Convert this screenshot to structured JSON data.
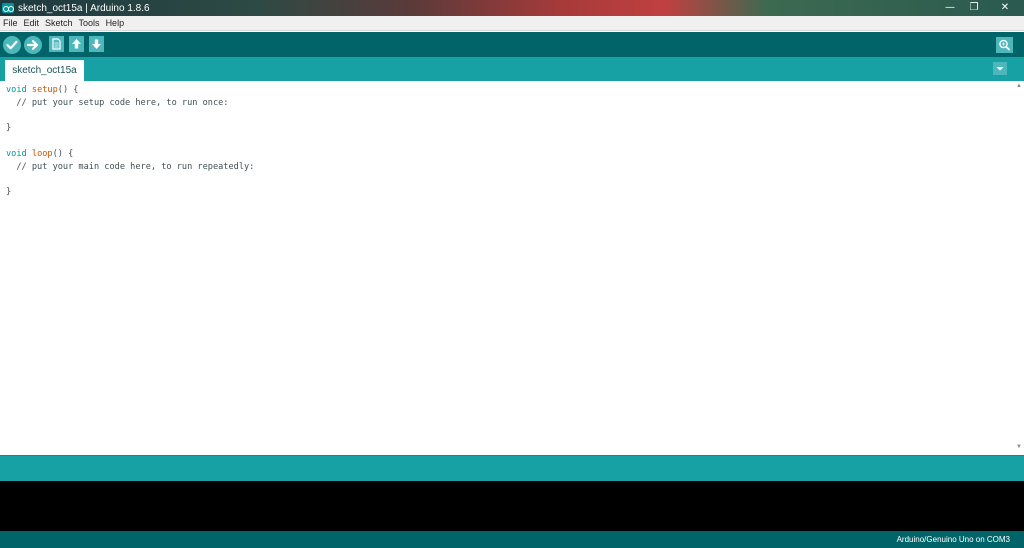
{
  "window": {
    "title": "sketch_oct15a | Arduino 1.8.6",
    "controls": {
      "minimize": "—",
      "restore": "❐",
      "close": "✕"
    }
  },
  "menu": [
    "File",
    "Edit",
    "Sketch",
    "Tools",
    "Help"
  ],
  "toolbar": {
    "buttons": [
      "verify-icon",
      "upload-icon",
      "new-icon",
      "open-icon",
      "save-icon"
    ],
    "right_button": "serial-monitor-icon"
  },
  "tabs": [
    {
      "label": "sketch_oct15a"
    }
  ],
  "editor": {
    "lines": [
      {
        "type": "void",
        "fn": "setup",
        "rest": "() {"
      },
      {
        "text": "  // put your setup code here, to run once:"
      },
      {
        "text": ""
      },
      {
        "text": "}"
      },
      {
        "text": ""
      },
      {
        "type": "void",
        "fn": "loop",
        "rest": "() {"
      },
      {
        "text": "  // put your main code here, to run repeatedly:"
      },
      {
        "text": ""
      },
      {
        "text": "}"
      }
    ]
  },
  "status": {
    "board": "Arduino/Genuino Uno on COM3"
  },
  "colors": {
    "toolbar": "#006468",
    "tabbar": "#17a1a5",
    "keyword": "#00979c",
    "function": "#d35400"
  }
}
